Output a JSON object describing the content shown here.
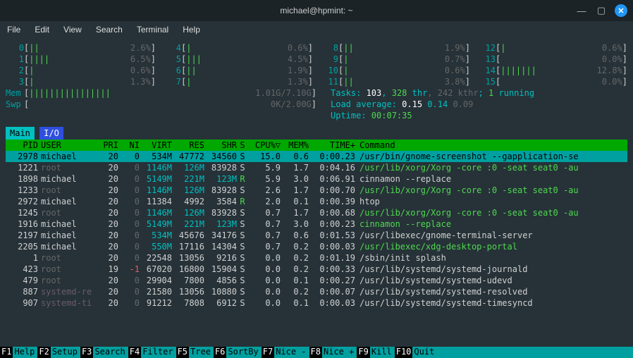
{
  "window": {
    "title": "michael@hpmint: ~"
  },
  "menu": [
    "File",
    "Edit",
    "View",
    "Search",
    "Terminal",
    "Help"
  ],
  "cpus": [
    {
      "n": "0",
      "pct": "2.6%",
      "bar": "||"
    },
    {
      "n": "4",
      "pct": "0.6%",
      "bar": "|"
    },
    {
      "n": "8",
      "pct": "1.9%",
      "bar": "||"
    },
    {
      "n": "12",
      "pct": "0.6%",
      "bar": "|"
    },
    {
      "n": "1",
      "pct": "6.5%",
      "bar": "||||"
    },
    {
      "n": "5",
      "pct": "4.5%",
      "bar": "|||"
    },
    {
      "n": "9",
      "pct": "0.7%",
      "bar": "|"
    },
    {
      "n": "13",
      "pct": "0.0%",
      "bar": ""
    },
    {
      "n": "2",
      "pct": "0.6%",
      "bar": "|"
    },
    {
      "n": "6",
      "pct": "1.9%",
      "bar": "||"
    },
    {
      "n": "10",
      "pct": "0.6%",
      "bar": "|"
    },
    {
      "n": "14",
      "pct": "12.8%",
      "bar": "|||||||"
    },
    {
      "n": "3",
      "pct": "1.3%",
      "bar": "|"
    },
    {
      "n": "7",
      "pct": "1.3%",
      "bar": "|"
    },
    {
      "n": "11",
      "pct": "3.8%",
      "bar": "||"
    },
    {
      "n": "15",
      "pct": "0.0%",
      "bar": ""
    }
  ],
  "mem": {
    "label": "Mem",
    "bar": "||||||||||||||||",
    "info": "1.01G/7.10G"
  },
  "swp": {
    "label": "Swp",
    "bar": "",
    "info": "0K/2.00G"
  },
  "tasks": {
    "total": "103",
    "thr": "328",
    "kthr": "242",
    "running": "1"
  },
  "load": {
    "a": "0.15",
    "b": "0.14",
    "c": "0.09"
  },
  "uptime": "00:07:35",
  "tabs": {
    "active": "Main",
    "inactive": "I/O"
  },
  "cols": {
    "pid": "PID",
    "user": "USER",
    "pri": "PRI",
    "ni": "NI",
    "virt": "VIRT",
    "res": "RES",
    "shr": "SHR",
    "s": "S",
    "cpu": "CPU%▽",
    "mem": "MEM%",
    "time": "TIME+",
    "cmd": "Command"
  },
  "procs": [
    {
      "sel": true,
      "pid": "2978",
      "user": "michael",
      "uc": "",
      "pri": "20",
      "ni": "0",
      "virt": "534M",
      "res": "47772",
      "shr": "34560",
      "s": "S",
      "cpu": "15.0",
      "mem": "0.6",
      "time": "0:00.23",
      "cmd": "/usr/bin/gnome-screenshot --gapplication-se",
      "cc": ""
    },
    {
      "pid": "1221",
      "user": "root",
      "uc": "dim",
      "pri": "20",
      "ni": "0",
      "nc": "dim",
      "virt": "1146M",
      "vc": "cy",
      "res": "126M",
      "rc": "cy",
      "shr": "83928",
      "s": "S",
      "cpu": "5.9",
      "mem": "1.7",
      "time": "0:04.16",
      "cmd": "/usr/lib/xorg/Xorg -core :0 -seat seat0 -au",
      "cc": "g"
    },
    {
      "pid": "1898",
      "user": "michael",
      "pri": "20",
      "ni": "0",
      "nc": "dim",
      "virt": "5149M",
      "vc": "cy",
      "res": "221M",
      "rc": "cy",
      "shr": "123M",
      "hc": "cy",
      "s": "R",
      "sc": "g",
      "cpu": "5.9",
      "mem": "3.0",
      "time": "0:06.91",
      "cmd": "cinnamon --replace"
    },
    {
      "pid": "1233",
      "user": "root",
      "uc": "dim",
      "pri": "20",
      "ni": "0",
      "nc": "dim",
      "virt": "1146M",
      "vc": "cy",
      "res": "126M",
      "rc": "cy",
      "shr": "83928",
      "s": "S",
      "cpu": "2.6",
      "mem": "1.7",
      "time": "0:00.70",
      "cmd": "/usr/lib/xorg/Xorg -core :0 -seat seat0 -au",
      "cc": "g"
    },
    {
      "pid": "2972",
      "user": "michael",
      "pri": "20",
      "ni": "0",
      "nc": "dim",
      "virt": "11384",
      "res": "4992",
      "shr": "3584",
      "s": "R",
      "sc": "g",
      "cpu": "2.0",
      "mem": "0.1",
      "time": "0:00.39",
      "cmd": "htop"
    },
    {
      "pid": "1245",
      "user": "root",
      "uc": "dim",
      "pri": "20",
      "ni": "0",
      "nc": "dim",
      "virt": "1146M",
      "vc": "cy",
      "res": "126M",
      "rc": "cy",
      "shr": "83928",
      "s": "S",
      "cpu": "0.7",
      "mem": "1.7",
      "time": "0:00.68",
      "cmd": "/usr/lib/xorg/Xorg -core :0 -seat seat0 -au",
      "cc": "g"
    },
    {
      "pid": "1916",
      "user": "michael",
      "pri": "20",
      "ni": "0",
      "nc": "dim",
      "virt": "5149M",
      "vc": "cy",
      "res": "221M",
      "rc": "cy",
      "shr": "123M",
      "hc": "cy",
      "s": "S",
      "cpu": "0.7",
      "mem": "3.0",
      "time": "0:00.23",
      "cmd": "cinnamon --replace",
      "cc": "g"
    },
    {
      "pid": "2197",
      "user": "michael",
      "pri": "20",
      "ni": "0",
      "nc": "dim",
      "virt": "534M",
      "vc": "cy",
      "res": "45676",
      "shr": "34176",
      "s": "S",
      "cpu": "0.7",
      "mem": "0.6",
      "time": "0:01.53",
      "cmd": "/usr/libexec/gnome-terminal-server"
    },
    {
      "pid": "2205",
      "user": "michael",
      "pri": "20",
      "ni": "0",
      "nc": "dim",
      "virt": "550M",
      "vc": "cy",
      "res": "17116",
      "shr": "14304",
      "s": "S",
      "cpu": "0.7",
      "mem": "0.2",
      "time": "0:00.03",
      "cmd": "/usr/libexec/xdg-desktop-portal",
      "cc": "g"
    },
    {
      "pid": "1",
      "user": "root",
      "uc": "dim",
      "pri": "20",
      "ni": "0",
      "nc": "dim",
      "virt": "22548",
      "res": "13056",
      "shr": "9216",
      "s": "S",
      "cpu": "0.0",
      "mem": "0.2",
      "time": "0:01.19",
      "cmd": "/sbin/init splash"
    },
    {
      "pid": "423",
      "user": "root",
      "uc": "dim",
      "pri": "19",
      "ni": "-1",
      "nc": "red",
      "virt": "67020",
      "res": "16800",
      "shr": "15904",
      "s": "S",
      "cpu": "0.0",
      "mem": "0.2",
      "time": "0:00.33",
      "cmd": "/usr/lib/systemd/systemd-journald"
    },
    {
      "pid": "479",
      "user": "root",
      "uc": "dim",
      "pri": "20",
      "ni": "0",
      "nc": "dim",
      "virt": "29904",
      "res": "7800",
      "shr": "4856",
      "s": "S",
      "cpu": "0.0",
      "mem": "0.1",
      "time": "0:00.27",
      "cmd": "/usr/lib/systemd/systemd-udevd"
    },
    {
      "pid": "887",
      "user": "systemd-re",
      "uc": "lg",
      "pri": "20",
      "ni": "0",
      "nc": "dim",
      "virt": "21580",
      "res": "13056",
      "shr": "10880",
      "s": "S",
      "cpu": "0.0",
      "mem": "0.2",
      "time": "0:00.07",
      "cmd": "/usr/lib/systemd/systemd-resolved"
    },
    {
      "pid": "907",
      "user": "systemd-ti",
      "uc": "lg",
      "pri": "20",
      "ni": "0",
      "nc": "dim",
      "virt": "91212",
      "res": "7808",
      "shr": "6912",
      "s": "S",
      "cpu": "0.0",
      "mem": "0.1",
      "time": "0:00.03",
      "cmd": "/usr/lib/systemd/systemd-timesyncd"
    }
  ],
  "fkeys": [
    {
      "k": "F1",
      "l": "Help  "
    },
    {
      "k": "F2",
      "l": "Setup "
    },
    {
      "k": "F3",
      "l": "Search"
    },
    {
      "k": "F4",
      "l": "Filter"
    },
    {
      "k": "F5",
      "l": "Tree  "
    },
    {
      "k": "F6",
      "l": "SortBy"
    },
    {
      "k": "F7",
      "l": "Nice -"
    },
    {
      "k": "F8",
      "l": "Nice +"
    },
    {
      "k": "F9",
      "l": "Kill  "
    },
    {
      "k": "F10",
      "l": "Quit"
    }
  ]
}
